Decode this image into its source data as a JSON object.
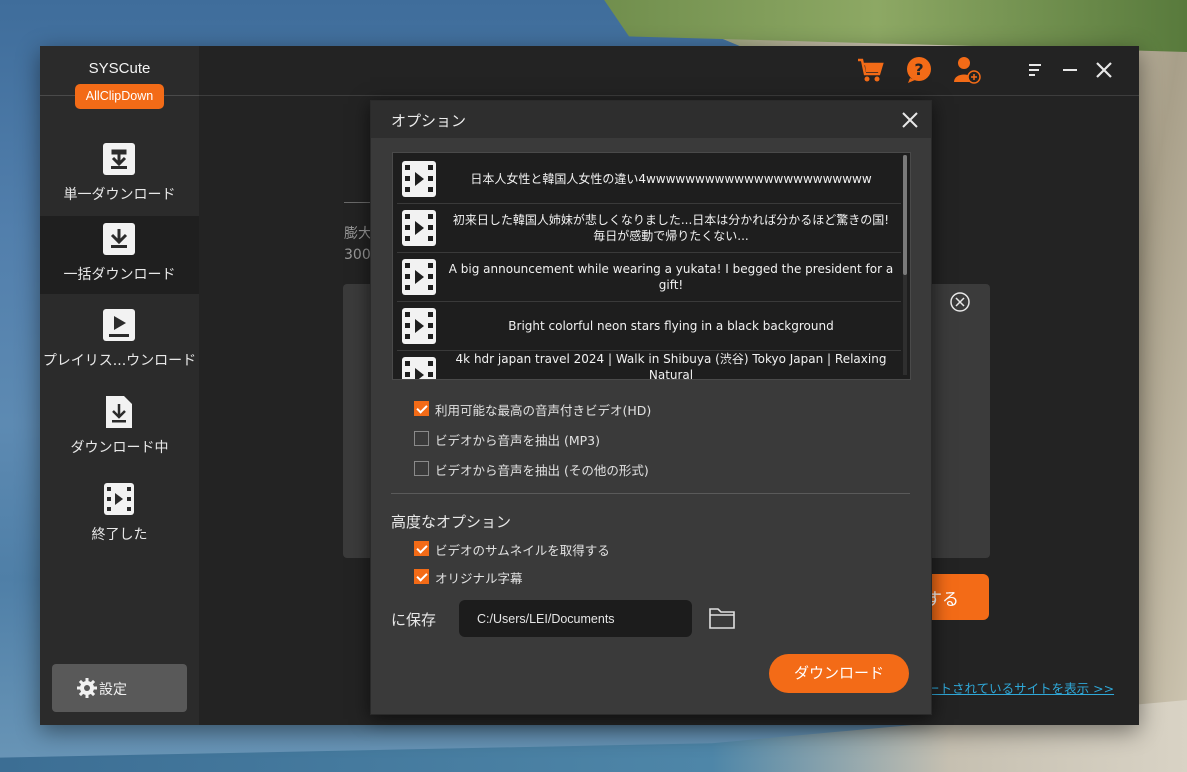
{
  "app": {
    "name": "SYSCute",
    "product_badge": "AllClipDown",
    "accent_color": "#f36b17"
  },
  "sidebar": {
    "items": [
      {
        "label": "単一ダウンロード",
        "icon": "download-icon",
        "active": false
      },
      {
        "label": "一括ダウンロード",
        "icon": "batch-download-icon",
        "active": true
      },
      {
        "label": "プレイリス...ウンロード",
        "icon": "playlist-icon",
        "active": false
      },
      {
        "label": "ダウンロード中",
        "icon": "downloading-icon",
        "active": false
      },
      {
        "label": "終了した",
        "icon": "finished-video-icon",
        "active": false
      }
    ],
    "settings_label": "設定"
  },
  "topbar": {
    "icons": [
      "cart-icon",
      "help-icon",
      "add-user-icon",
      "menu-icon",
      "minimize-icon",
      "close-icon"
    ]
  },
  "background": {
    "text_1": "膨大",
    "text_2": "300",
    "button_fragment": "する",
    "link_fragment": "ートされているサイトを表示 >>"
  },
  "dialog": {
    "title": "オプション",
    "videos": [
      {
        "title": "日本人女性と韓国人女性の違い4wwwwwwwwwwwwwwwwwwwwwww"
      },
      {
        "title": "初来日した韓国人姉妹が悲しくなりました...日本は分かれば分かるほど驚きの国! 毎日が感動で帰りたくない..."
      },
      {
        "title": "A big announcement while wearing a yukata! I begged the president for a gift!"
      },
      {
        "title": "Bright colorful neon stars flying in a black background"
      },
      {
        "title": "4k hdr japan travel 2024 | Walk in Shibuya (渋谷) Tokyo Japan |  Relaxing Natural"
      }
    ],
    "format_options": [
      {
        "label": "利用可能な最高の音声付きビデオ(HD)",
        "checked": true
      },
      {
        "label": "ビデオから音声を抽出 (MP3)",
        "checked": false
      },
      {
        "label": "ビデオから音声を抽出 (その他の形式)",
        "checked": false
      }
    ],
    "advanced_title": "高度なオプション",
    "advanced_options": [
      {
        "label": "ビデオのサムネイルを取得する",
        "checked": true
      },
      {
        "label": "オリジナル字幕",
        "checked": true
      }
    ],
    "save_label": "に保存",
    "save_path": "C:/Users/LEI/Documents",
    "download_button": "ダウンロード"
  }
}
